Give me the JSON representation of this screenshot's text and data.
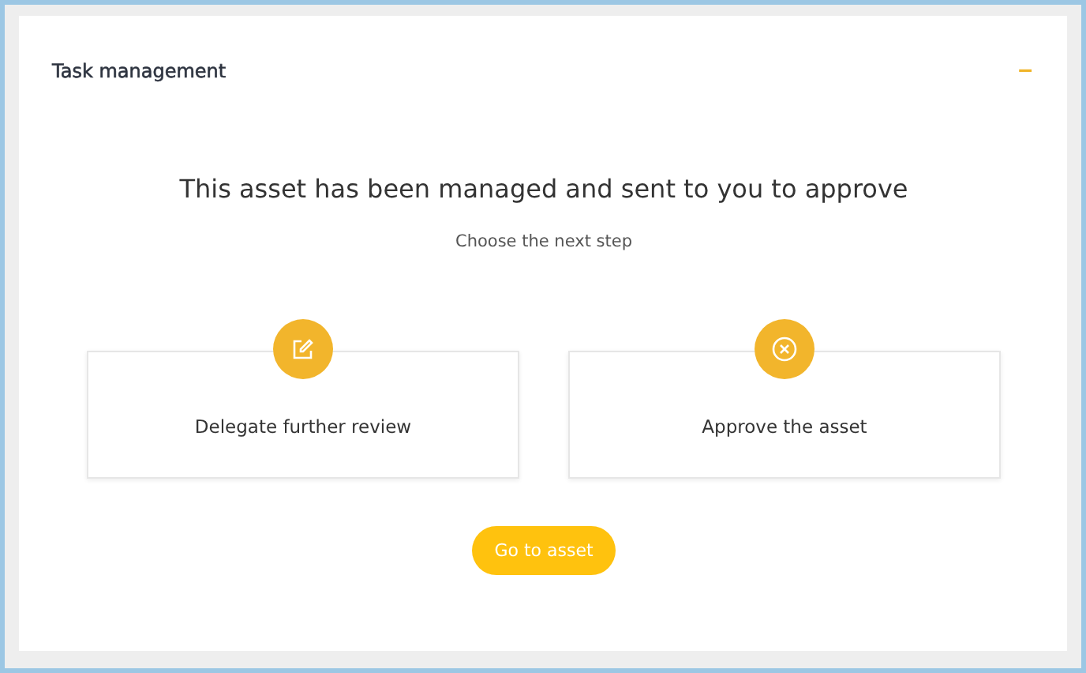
{
  "panel": {
    "title": "Task management",
    "collapse_icon": "–"
  },
  "heading": "This asset has been managed and sent to you to approve",
  "subheading": "Choose the next step",
  "options": [
    {
      "label": "Delegate further review",
      "kind": "edit"
    },
    {
      "label": "Approve the asset",
      "kind": "cancel"
    }
  ],
  "button": "Go to asset"
}
